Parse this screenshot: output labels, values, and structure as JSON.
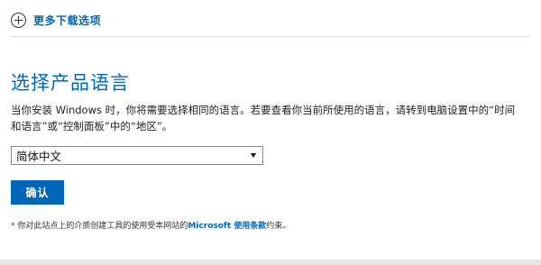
{
  "more_downloads": {
    "label": "更多下载选项",
    "icon": "plus-circle-icon"
  },
  "section": {
    "title": "选择产品语言",
    "description": "当你安装 Windows 时，你将需要选择相同的语言。若要查看你当前所使用的语言，请转到电脑设置中的“时间和语言”或“控制面板”中的“地区”。"
  },
  "language_select": {
    "selected": "简体中文",
    "icon": "chevron-down-icon"
  },
  "confirm_button": {
    "label": "确认"
  },
  "footnote": {
    "prefix": "* 你对此站点上的介质创建工具的使用受本网站的",
    "link_text": "Microsoft 使用条款",
    "suffix": "约束。"
  },
  "colors": {
    "accent": "#0067b8",
    "text": "#222222",
    "divider": "#dcdcdc"
  }
}
